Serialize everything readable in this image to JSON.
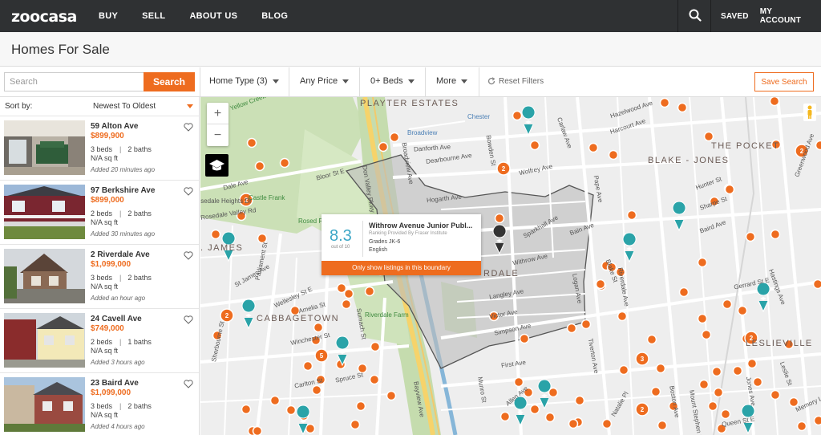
{
  "nav": {
    "logo": "zoocasa",
    "links": [
      "BUY",
      "SELL",
      "ABOUT US",
      "BLOG"
    ],
    "saved": "SAVED",
    "account": "MY ACCOUNT"
  },
  "page_title": "Homes For Sale",
  "filters": {
    "search_placeholder": "Search",
    "search_button": "Search",
    "home_type": "Home Type (3)",
    "price": "Any Price",
    "beds": "0+ Beds",
    "more": "More",
    "reset": "Reset Filters",
    "save_search": "Save Search"
  },
  "sort": {
    "label": "Sort by:",
    "value": "Newest To Oldest"
  },
  "listings": [
    {
      "address": "59 Alton Ave",
      "price": "$899,900",
      "beds": "3 beds",
      "baths": "2 baths",
      "size": "N/A sq ft",
      "added": "Added 20 minutes ago"
    },
    {
      "address": "97 Berkshire Ave",
      "price": "$899,000",
      "beds": "2 beds",
      "baths": "2 baths",
      "size": "N/A sq ft",
      "added": "Added 30 minutes ago"
    },
    {
      "address": "2 Riverdale Ave",
      "price": "$1,099,000",
      "beds": "3 beds",
      "baths": "2 baths",
      "size": "N/A sq ft",
      "added": "Added an hour ago"
    },
    {
      "address": "24 Cavell Ave",
      "price": "$749,000",
      "beds": "2 beds",
      "baths": "1 baths",
      "size": "N/A sq ft",
      "added": "Added 3 hours ago"
    },
    {
      "address": "23 Baird Ave",
      "price": "$1,099,000",
      "beds": "3 beds",
      "baths": "2 baths",
      "size": "N/A sq ft",
      "added": "Added 4 hours ago"
    }
  ],
  "popup": {
    "score": "8.3",
    "out_of": "out of 10",
    "school": "Withrow Avenue Junior Publ...",
    "ranking": "Ranking Provided By Fraser Institute",
    "grades": "Grades JK-6",
    "language": "English",
    "button": "Only show listings in this boundary"
  },
  "map": {
    "areas": [
      "PLAYTER ESTATES",
      "THE POCKET",
      "BLAKE - JONES",
      "CABBAGETOWN",
      "LESLIEVILLE",
      "RDALE",
      ". JAMES"
    ],
    "labels": [
      "Yellow Creek",
      "Chester",
      "Broadview",
      "Castle Frank",
      "Rosedale Valley Rd",
      "Riverdale Farm",
      "Rosed Ravine L",
      "Dale Ave",
      "Bloor St E",
      "Rosedale Heights Dr",
      "Danforth Ave",
      "Hazelwood Ave",
      "Harcourt Ave",
      "Wolfrey Ave",
      "Hogarth Ave",
      "Dearbourne Ave",
      "Simpson Ave",
      "Withrow Ave",
      "Langley Ave",
      "Victor Ave",
      "Bain Ave",
      "Sparkhall Ave",
      "Gerrard St E",
      "Queen St E",
      "Wellesley St E",
      "Winchester St",
      "Carlton St",
      "Spruce St",
      "First Ave",
      "Sumach St",
      "Parliament St",
      "Sherbourne St",
      "Bayview Ave",
      "Broadview Ave",
      "Don Valley Pkwy",
      "Logan Ave",
      "Pape Ave",
      "Jones Ave",
      "Greenwood Ave",
      "Carlaw Ave",
      "Hunter St",
      "Sharpe St",
      "Baird Ave",
      "Boston Ave",
      "Hastings Ave",
      "Leslie St",
      "Memory Ln",
      "Munro St",
      "Tiverton Ave",
      "Natalie Pl",
      "Allen Ave",
      "Blake St",
      "Bowden St",
      "Mount Stephen St",
      "Amelia St",
      "Riverdale Ave",
      "St James Ave"
    ],
    "cluster_counts": [
      "2",
      "2",
      "2",
      "2",
      "5",
      "3",
      "2",
      "2"
    ]
  }
}
